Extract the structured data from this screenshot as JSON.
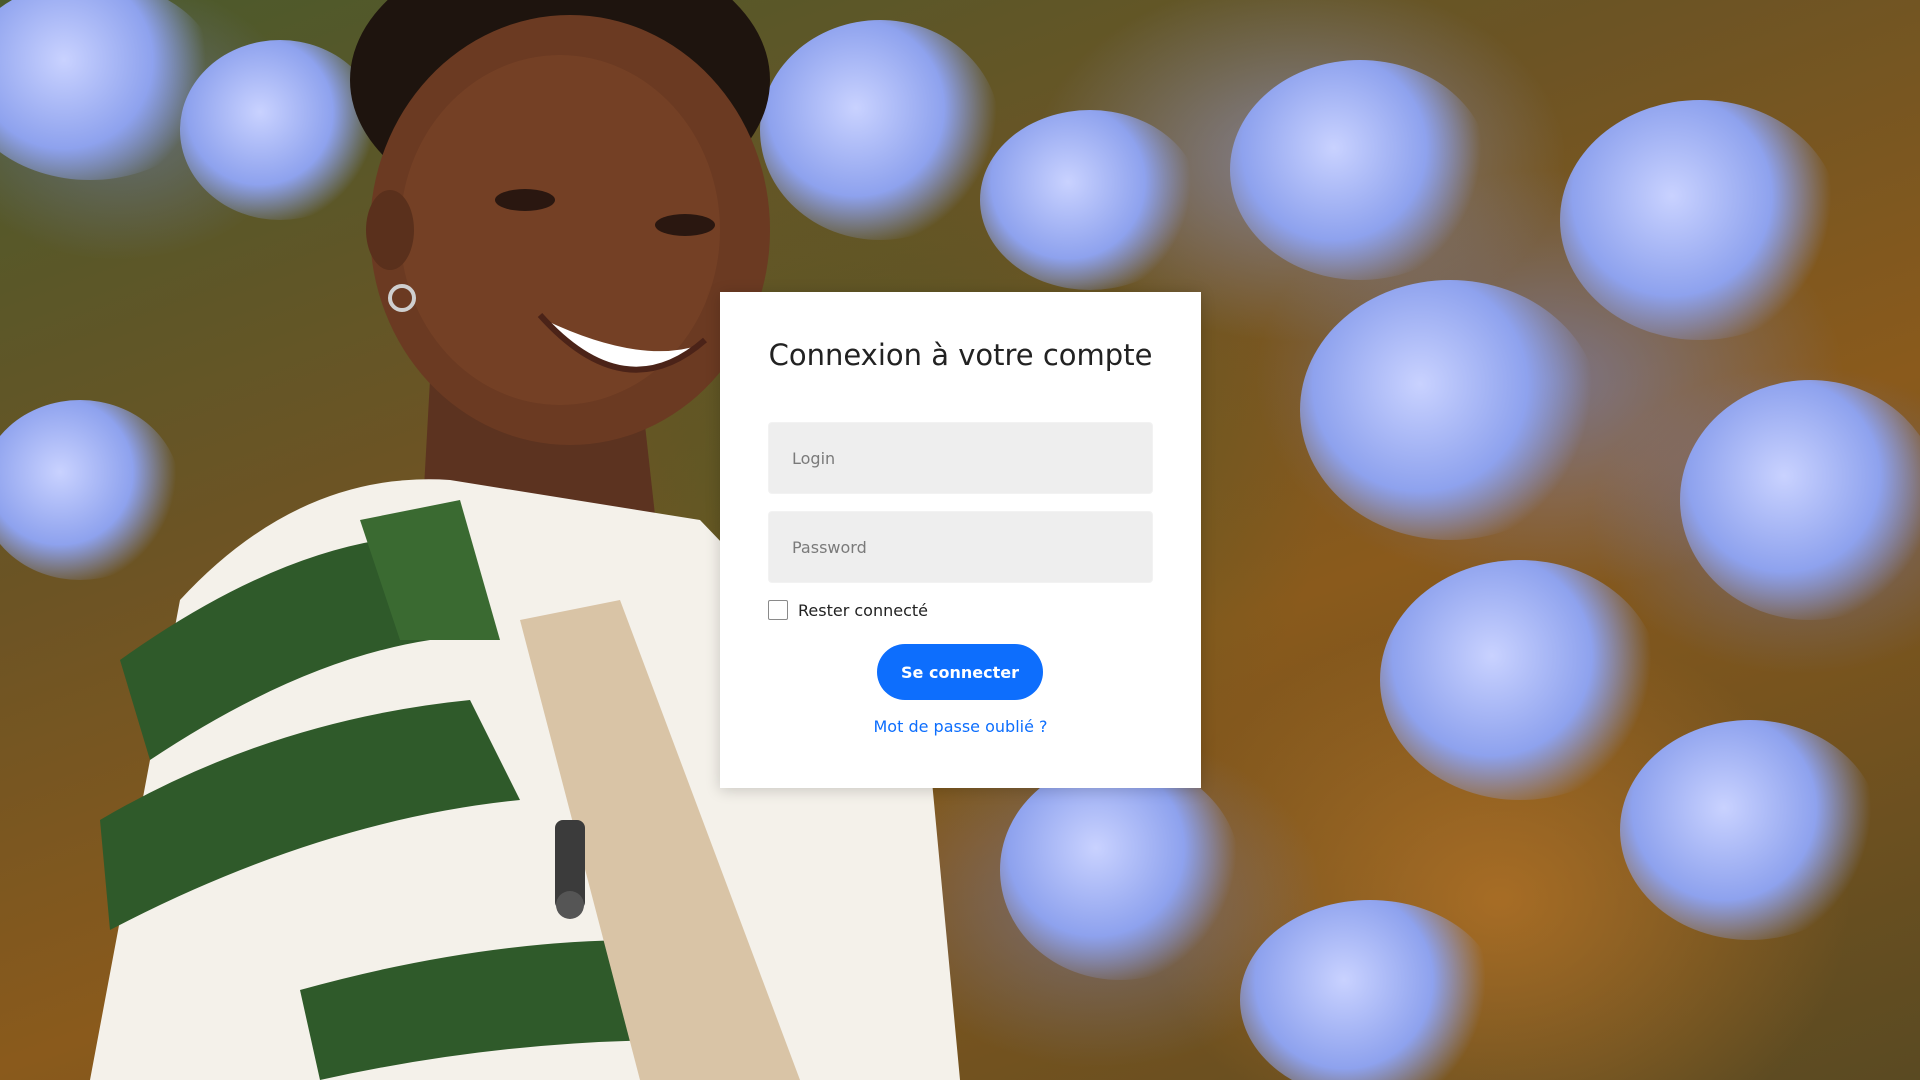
{
  "background": {
    "description_icon": "photo-background",
    "accent_colors": [
      "#8ea2ee",
      "#3f6b3a",
      "#8a5a1c"
    ]
  },
  "login_card": {
    "title": "Connexion à votre compte",
    "login_placeholder": "Login",
    "login_value": "",
    "password_placeholder": "Password",
    "password_value": "",
    "remember_label": "Rester connecté",
    "remember_checked": false,
    "submit_label": "Se connecter",
    "forgot_label": "Mot de passe oublié ?",
    "accent_color": "#0d6efd"
  }
}
